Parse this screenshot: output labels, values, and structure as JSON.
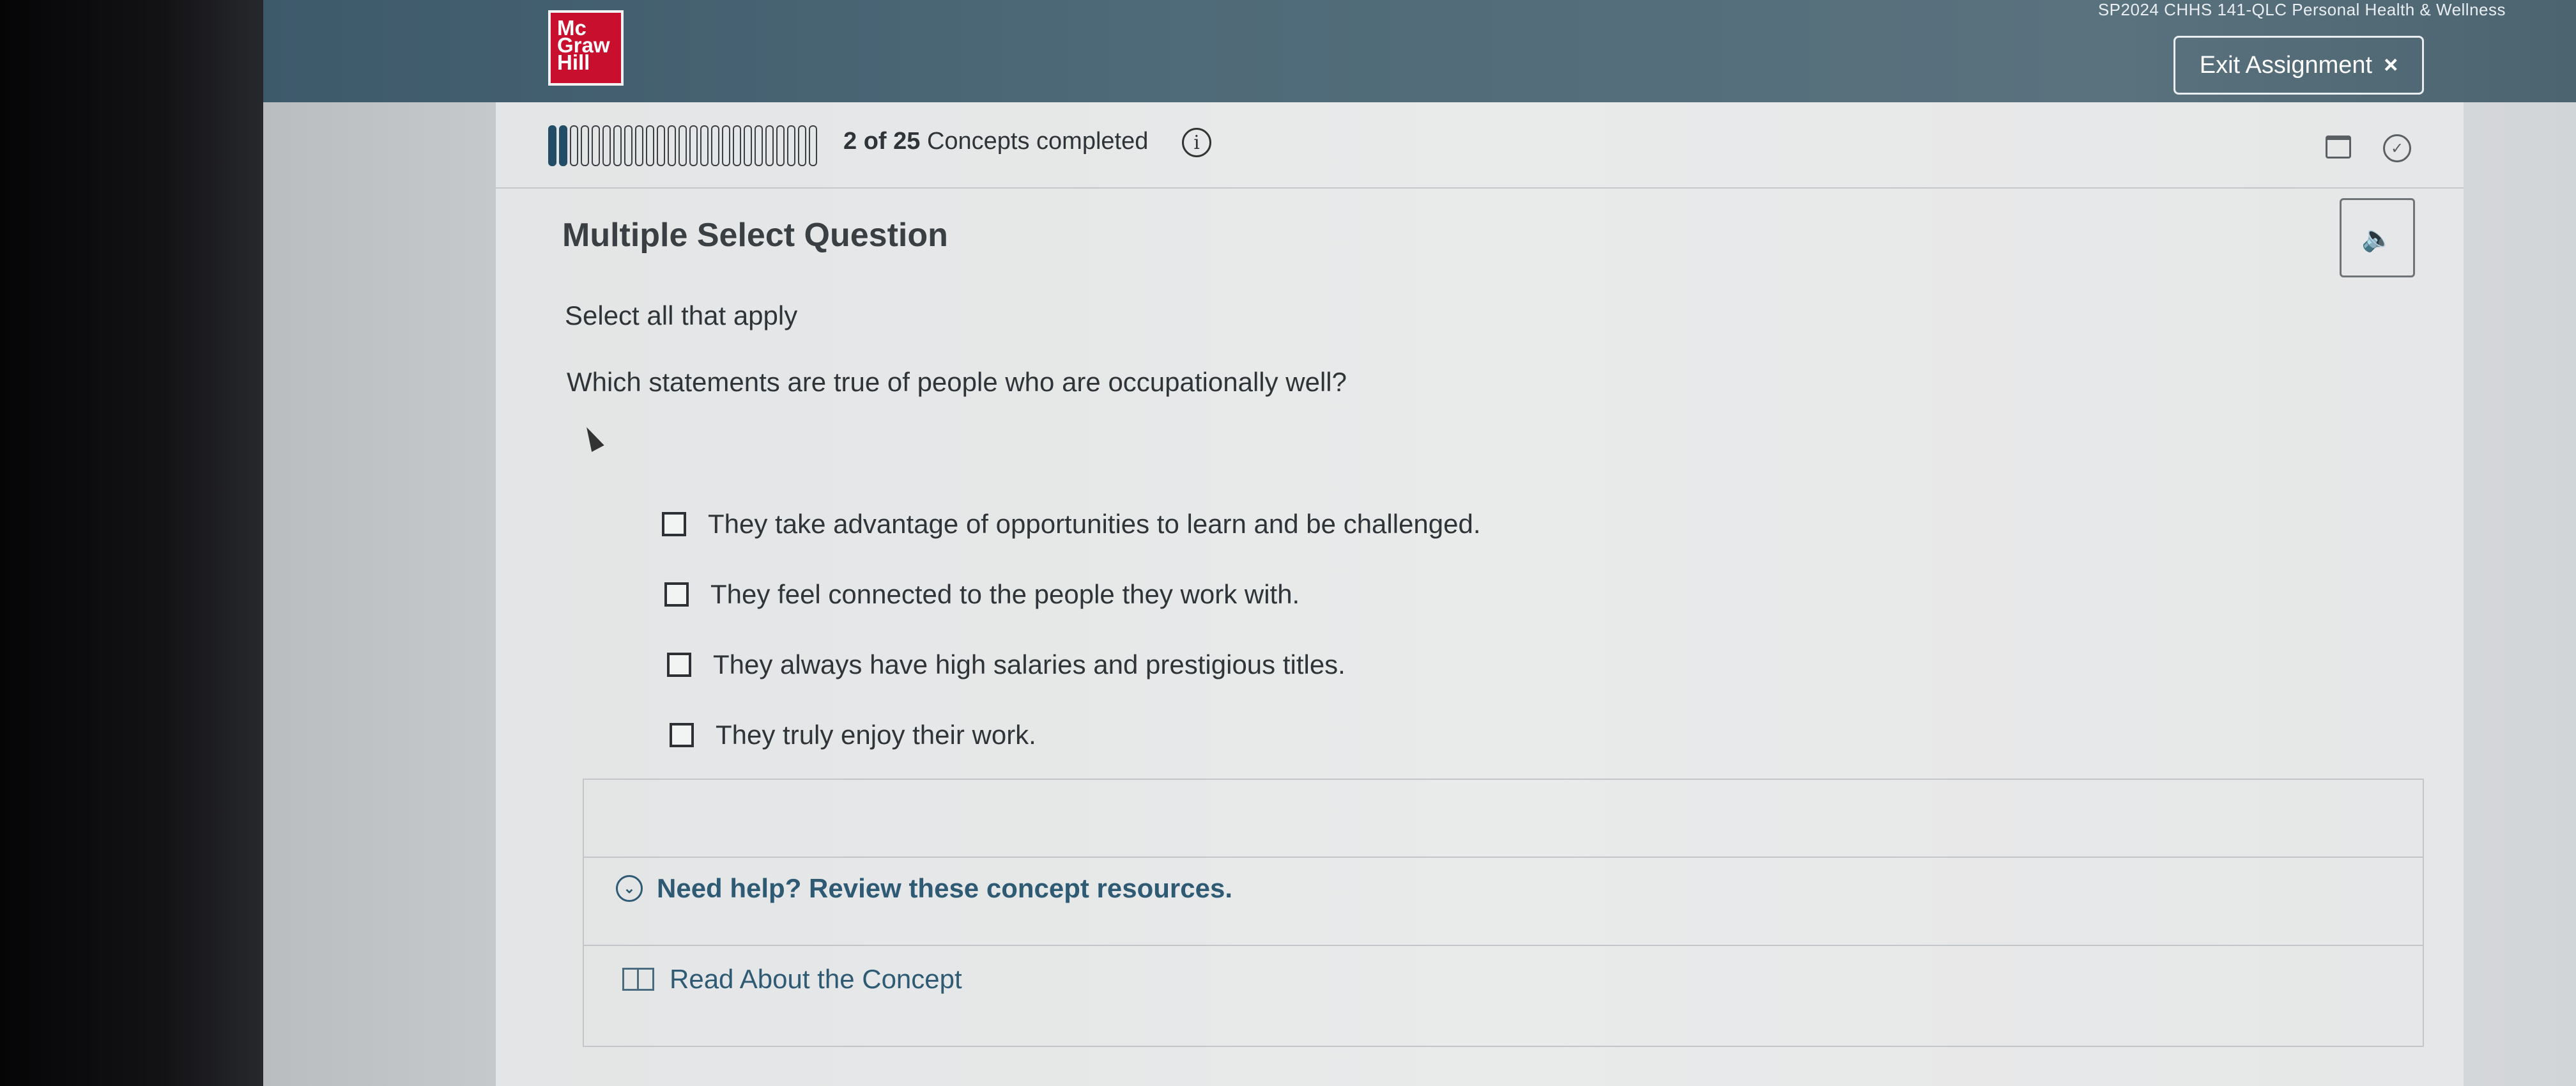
{
  "header": {
    "course_title": "SP2024 CHHS 141-QLC Personal Health & Wellness",
    "logo": {
      "line1": "Mc",
      "line2": "Graw",
      "line3": "Hill"
    },
    "exit_label": "Exit Assignment",
    "exit_icon": "×"
  },
  "progress": {
    "completed": 2,
    "total": 25,
    "count_label": "2 of 25",
    "suffix": "Concepts completed",
    "info_icon": "i"
  },
  "toolbar": {
    "calendar_icon": "calendar-icon",
    "timer_icon": "timer-icon",
    "audio_icon": "speaker-icon"
  },
  "question": {
    "type": "Multiple Select Question",
    "instruction": "Select all that apply",
    "prompt": "Which statements are true of people who are occupationally well?",
    "options": [
      {
        "label": "They take advantage of opportunities to learn and be challenged.",
        "checked": false
      },
      {
        "label": "They feel connected to the people they work with.",
        "checked": false
      },
      {
        "label": "They always have high salaries and prestigious titles.",
        "checked": false
      },
      {
        "label": "They truly enjoy their work.",
        "checked": false
      }
    ]
  },
  "help": {
    "toggle_label": "Need help? Review these concept resources.",
    "resource_label": "Read About the Concept"
  },
  "colors": {
    "header_bg": "#4f6a78",
    "brand_red": "#c8102e",
    "link_blue": "#2e5a73",
    "progress_done": "#234d66"
  }
}
